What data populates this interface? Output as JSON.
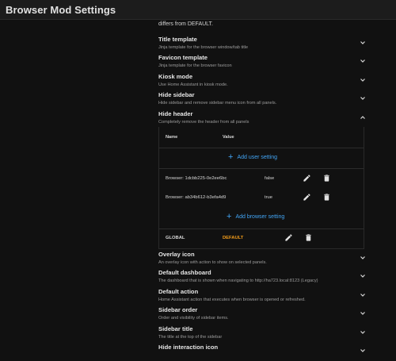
{
  "app": {
    "title": "Browser Mod Settings"
  },
  "intro_text": "differs from DEFAULT.",
  "items_top": [
    {
      "title": "Title template",
      "desc": "Jinja template for the browser window/tab title"
    },
    {
      "title": "Favicon template",
      "desc": "Jinja template for the browser favicon"
    },
    {
      "title": "Kiosk mode",
      "desc": "Use Home Assistant in kiosk mode."
    },
    {
      "title": "Hide sidebar",
      "desc": "Hide sidebar and remove sidebar menu icon from all panels."
    },
    {
      "title": "Hide header",
      "desc": "Completely remove the header from all panels"
    }
  ],
  "panel": {
    "col_name": "Name",
    "col_value": "Value",
    "add_user_label": "Add user setting",
    "browser_rows": [
      {
        "name": "Browser: 1dcbb225-0e2ee6bc",
        "value": "false"
      },
      {
        "name": "Browser: ab34b612-b3efa4d9",
        "value": "true"
      }
    ],
    "add_browser_label": "Add browser setting",
    "global_name": "GLOBAL",
    "global_value": "DEFAULT"
  },
  "items_bottom": [
    {
      "title": "Overlay icon",
      "desc": "An overlay icon with action to show on selected panels."
    },
    {
      "title": "Default dashboard",
      "desc": "The dashboard that is shown when navigating to http://ha723.local:8123 (Legacy)"
    },
    {
      "title": "Default action",
      "desc": "Home Assistant action that executes when browser is opened or refreshed."
    },
    {
      "title": "Sidebar order",
      "desc": "Order and visibility of sidebar items."
    },
    {
      "title": "Sidebar title",
      "desc": "The title at the top of the sidebar"
    },
    {
      "title": "Hide interaction icon",
      "desc": ""
    }
  ],
  "colors": {
    "accent_blue": "#42a5f5",
    "default_orange": "#f09a1a",
    "background": "#111111"
  },
  "icons": {
    "collapsed": "chevron-down-icon",
    "expanded": "chevron-up-icon",
    "edit": "pencil-icon",
    "delete": "trash-icon",
    "add": "plus-icon"
  }
}
